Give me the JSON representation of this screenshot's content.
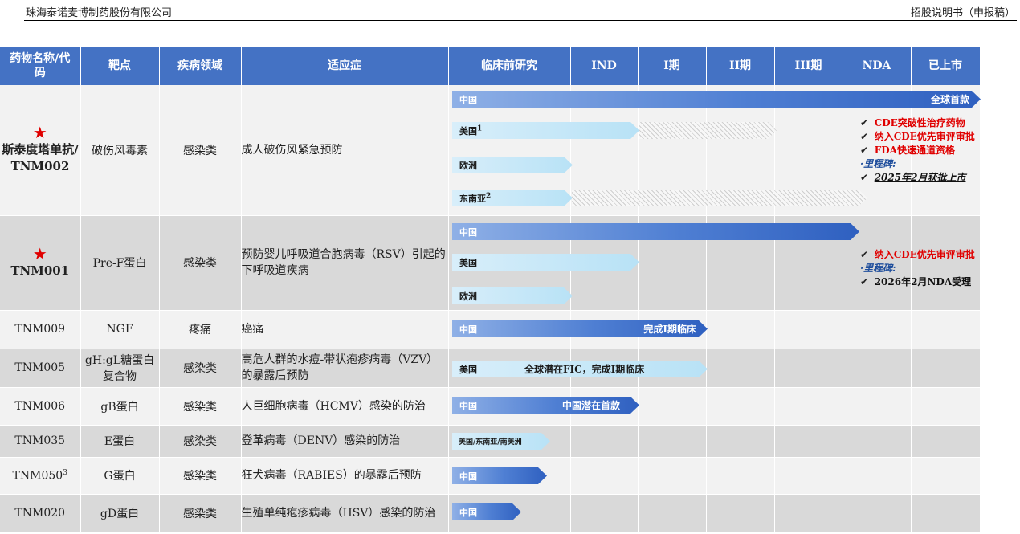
{
  "page_header": {
    "company": "珠海泰诺麦博制药股份有限公司",
    "doc": "招股说明书（申报稿）"
  },
  "columns": [
    "药物名称/代码",
    "靶点",
    "疾病领域",
    "适应症",
    "临床前研究",
    "IND",
    "I期",
    "II期",
    "III期",
    "NDA",
    "已上市"
  ],
  "rows": [
    {
      "star": "★",
      "name": "斯泰度塔单抗/TNM002",
      "target": "破伤风毒素",
      "area": "感染类",
      "indication": "成人破伤风紧急预防",
      "bars": [
        {
          "region": "中国",
          "label": "全球首款",
          "reach_stage": "已上市"
        },
        {
          "region": "美国",
          "sup": "1",
          "reach_stage": "IND",
          "hatched_to": "II期"
        },
        {
          "region": "欧洲",
          "reach_stage": "临床前研究"
        },
        {
          "region": "东南亚",
          "sup": "2",
          "reach_stage": "临床前研究",
          "hatched_to": "NDA"
        }
      ],
      "notes": [
        {
          "check": "✔",
          "text": "CDE突破性治疗药物",
          "style": "red"
        },
        {
          "check": "✔",
          "text": "纳入CDE优先审评审批",
          "style": "red"
        },
        {
          "check": "✔",
          "text": "FDA快速通道资格",
          "style": "red"
        },
        {
          "check": "",
          "text": "·里程碑:",
          "style": "blue"
        },
        {
          "check": "✔",
          "text": "2025年2月获批上市",
          "style": "black-underline"
        }
      ]
    },
    {
      "star": "★",
      "name": "TNM001",
      "target": "Pre-F蛋白",
      "area": "感染类",
      "indication": "预防婴儿呼吸道合胞病毒（RSV）引起的下呼吸道疾病",
      "bars": [
        {
          "region": "中国",
          "reach_stage": "NDA"
        },
        {
          "region": "美国",
          "reach_stage": "IND"
        },
        {
          "region": "欧洲",
          "reach_stage": "临床前研究"
        }
      ],
      "notes": [
        {
          "check": "✔",
          "text": "纳入CDE优先审评审批",
          "style": "red"
        },
        {
          "check": "",
          "text": "·里程碑:",
          "style": "blue"
        },
        {
          "check": "✔",
          "text": "2026年2月NDA受理",
          "style": "black"
        }
      ]
    },
    {
      "name": "TNM009",
      "target": "NGF",
      "area": "疼痛",
      "indication": "癌痛",
      "bars": [
        {
          "region": "中国",
          "label": "完成I期临床",
          "reach_stage": "I期"
        }
      ]
    },
    {
      "name": "TNM005",
      "target": "gH:gL糖蛋白复合物",
      "area": "感染类",
      "indication": "高危人群的水痘-带状疱疹病毒（VZV）的暴露后预防",
      "bars": [
        {
          "region": "美国",
          "label": "全球潜在FIC，完成I期临床",
          "reach_stage": "I期"
        }
      ]
    },
    {
      "name": "TNM006",
      "target": "gB蛋白",
      "area": "感染类",
      "indication": "人巨细胞病毒（HCMV）感染的防治",
      "bars": [
        {
          "region": "中国",
          "label": "中国潜在首款",
          "reach_stage": "IND"
        }
      ]
    },
    {
      "name": "TNM035",
      "target": "E蛋白",
      "area": "感染类",
      "indication": "登革病毒（DENV）感染的防治",
      "bars": [
        {
          "region": "美国/东南亚/南美洲",
          "reach_stage": "临床前研究"
        }
      ]
    },
    {
      "name": "TNM050",
      "sup": "3",
      "target": "G蛋白",
      "area": "感染类",
      "indication": "狂犬病毒（RABIES）的暴露后预防",
      "bars": [
        {
          "region": "中国",
          "reach_stage": "临床前研究"
        }
      ]
    },
    {
      "name": "TNM020",
      "target": "gD蛋白",
      "area": "感染类",
      "indication": "生殖单纯疱疹病毒（HSV）感染的防治",
      "bars": [
        {
          "region": "中国",
          "reach_stage": "临床前研究"
        }
      ]
    }
  ]
}
